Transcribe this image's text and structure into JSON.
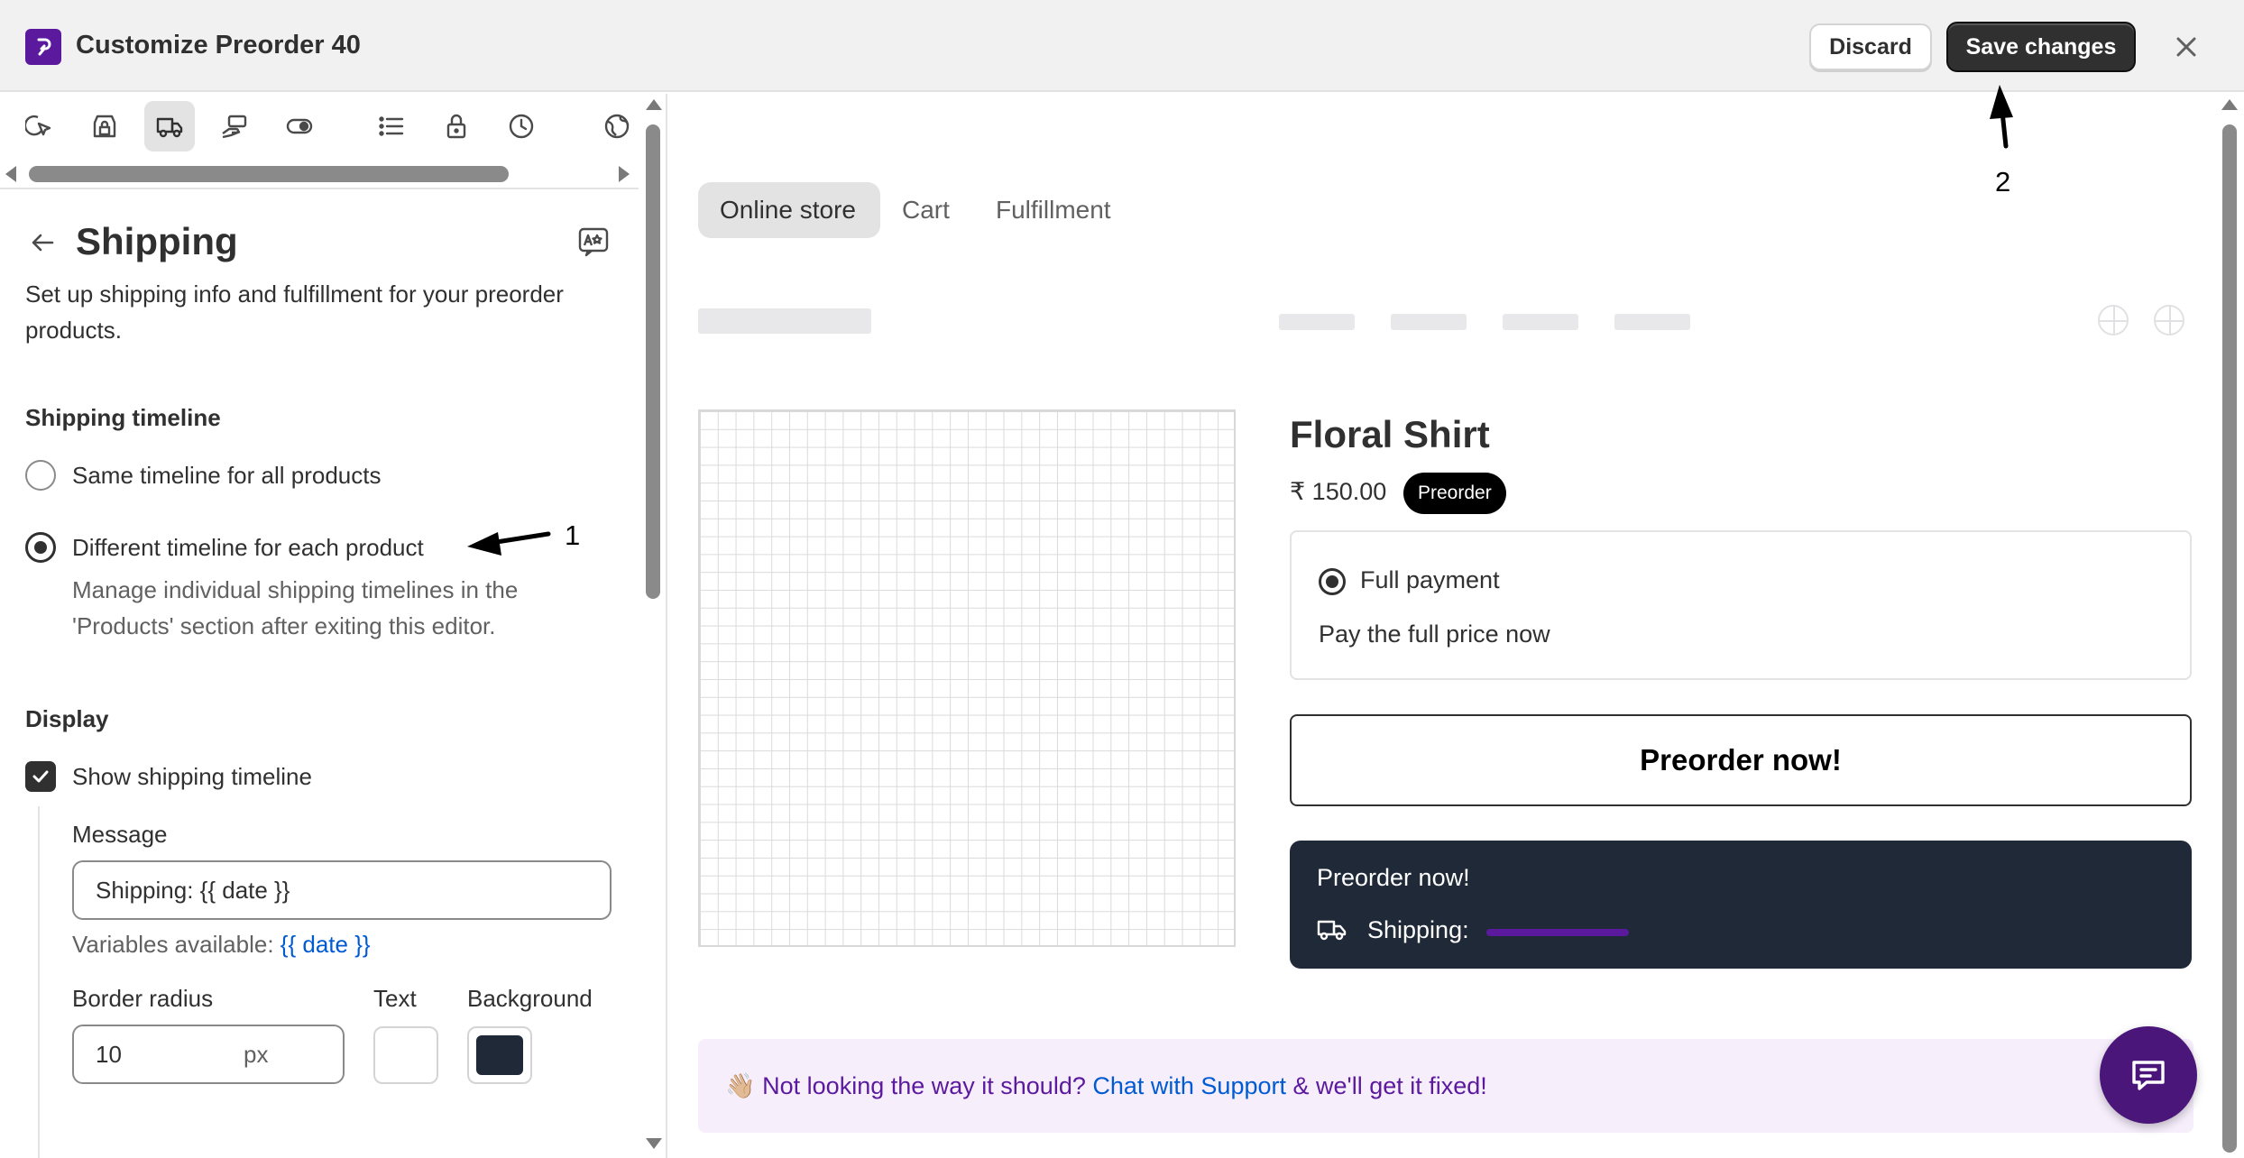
{
  "titlebar": {
    "title": "Customize Preorder 40",
    "discard_label": "Discard",
    "save_label": "Save changes"
  },
  "left_panel": {
    "icon_tabs": [
      "cursor-click-icon",
      "store-lock-icon",
      "truck-icon",
      "hand-money-icon",
      "toggle-icon",
      "list-icon",
      "lock-icon",
      "clock-icon",
      "globe-icon"
    ],
    "active_tab": "truck-icon",
    "section_title": "Shipping",
    "description": "Set up shipping info and fulfillment for your preorder products.",
    "shipping_timeline": {
      "heading": "Shipping timeline",
      "option_same": "Same timeline for all products",
      "option_different": "Different timeline for each product",
      "selected": "option_different",
      "help_text": "Manage individual shipping timelines in the 'Products' section after exiting this editor."
    },
    "display": {
      "heading": "Display",
      "show_timeline_label": "Show shipping timeline",
      "show_timeline_checked": true,
      "message_label": "Message",
      "message_value": "Shipping: {{ date }}",
      "variables_prefix": "Variables available:",
      "variables_code": "{{ date }}",
      "border_radius_label": "Border radius",
      "border_radius_value": "10",
      "border_radius_unit": "px",
      "text_label": "Text",
      "text_color": "#ffffff",
      "background_label": "Background",
      "background_color": "#1f2937"
    }
  },
  "preview": {
    "tabs": [
      "Online store",
      "Cart",
      "Fulfillment"
    ],
    "active_tab": "Online store",
    "product_title": "Floral Shirt",
    "price": "₹ 150.00",
    "badge": "Preorder",
    "payment_option": "Full payment",
    "payment_desc": "Pay the full price now",
    "preorder_button": "Preorder now!",
    "shipping_box_title": "Preorder now!",
    "shipping_label": "Shipping:",
    "support_emoji": "👋🏼",
    "support_before": "Not looking the way it should?",
    "support_link": "Chat with Support",
    "support_after": "& we'll get it fixed!"
  },
  "annotations": {
    "marker_1": "1",
    "marker_2": "2"
  },
  "colors": {
    "brand": "#5b1a9e",
    "primary_button": "#303030",
    "shipping_box_bg": "#1f2937",
    "link": "#005bd3"
  }
}
